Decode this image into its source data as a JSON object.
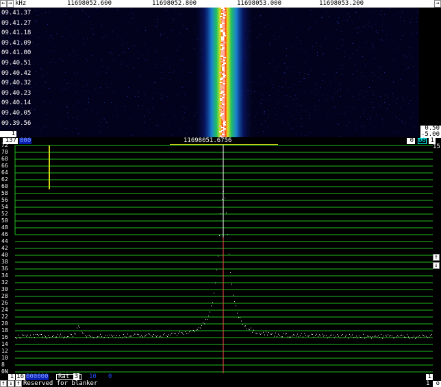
{
  "ruler": {
    "left_arrow": "←",
    "right_arrow": "→",
    "unit": "kHz",
    "labels": [
      "11698052.600",
      "11698052.800",
      "11698053.000",
      "11698053.200"
    ]
  },
  "waterfall": {
    "times": [
      "09.41.37",
      "09.41.27",
      "09.41.18",
      "09.41.09",
      "09.41.00",
      "09.40.51",
      "09.40.42",
      "09.40.32",
      "09.40.23",
      "09.40.14",
      "09.40.05",
      "09.39.56"
    ],
    "bottom_left_box": "1",
    "scale_top": "0.50",
    "scale_bottom": "-5.00"
  },
  "midstrip": {
    "left_value": "137",
    "left_badge": "000",
    "center_freq": "11698051.6756",
    "right_value": "0",
    "right_badge": "00",
    "right_extra": "1",
    "right_edge": "15"
  },
  "spectrum": {
    "y_labels": [
      "72",
      "70",
      "68",
      "66",
      "64",
      "62",
      "60",
      "58",
      "56",
      "54",
      "52",
      "50",
      "48",
      "46",
      "44",
      "42",
      "40",
      "38",
      "36",
      "34",
      "32",
      "30",
      "28",
      "26",
      "24",
      "22",
      "20",
      "18",
      "16",
      "14",
      "12",
      "10",
      "8",
      "6",
      "4",
      "2",
      "0N"
    ],
    "up_arrow": "↑",
    "down_arrow": "↓"
  },
  "bottom": {
    "row1": {
      "box1": "1",
      "box2": "16",
      "blue1": "000000",
      "rat_label": "Rat",
      "rat_value": "3",
      "blue2": "10",
      "blue3": "0",
      "right_box": "1"
    },
    "row2": {
      "status": "Reserved for blanker",
      "right_value": "1",
      "right_letter": "o"
    }
  },
  "colors": {
    "grid_green": "#1fbf1f",
    "yellow_marker": "#d4d41a",
    "trace": "#ffffff",
    "center_line": "#ff5050"
  }
}
